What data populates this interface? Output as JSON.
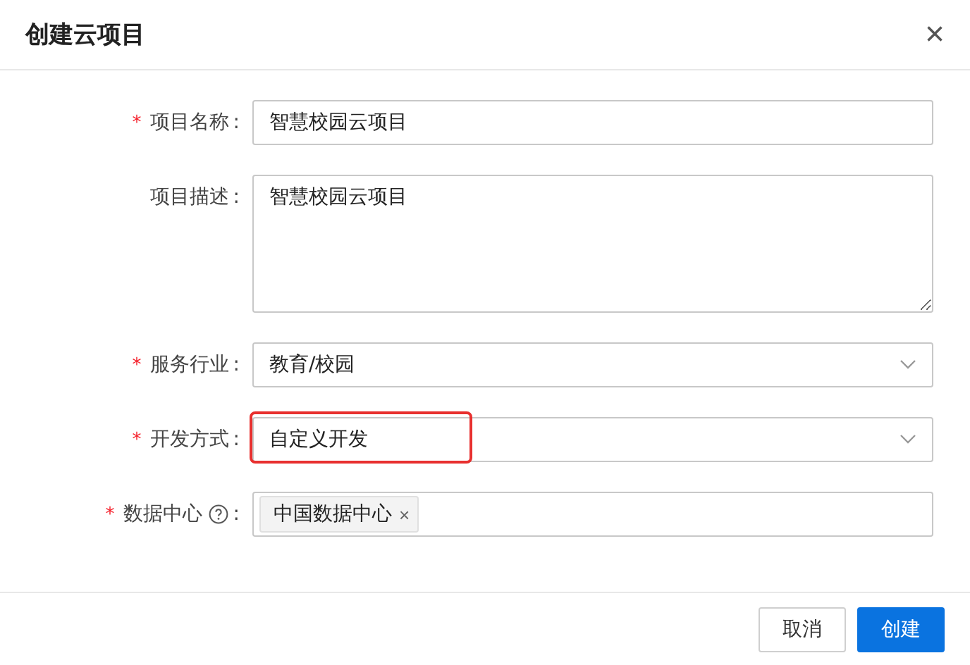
{
  "dialog": {
    "title": "创建云项目",
    "close": "×"
  },
  "fields": [
    {
      "kind": "input",
      "required_mark": "*",
      "label": "项目名称",
      "colon": ":",
      "value": "智慧校园云项目"
    },
    {
      "kind": "textarea",
      "label": "项目描述",
      "colon": ":",
      "value": "智慧校园云项目"
    },
    {
      "kind": "select",
      "required_mark": "*",
      "label": "服务行业",
      "colon": ":",
      "value": "教育/校园"
    },
    {
      "kind": "select",
      "required_mark": "*",
      "label": "开发方式",
      "colon": ":",
      "value": "自定义开发",
      "highlighted": true
    },
    {
      "kind": "tags",
      "required_mark": "*",
      "label": "数据中心",
      "help": true,
      "colon": ":",
      "tags": [
        {
          "label": "中国数据中心",
          "remove": "×"
        }
      ]
    }
  ],
  "buttons": [
    {
      "label": "取消",
      "primary": false
    },
    {
      "label": "创建",
      "primary": true
    }
  ]
}
